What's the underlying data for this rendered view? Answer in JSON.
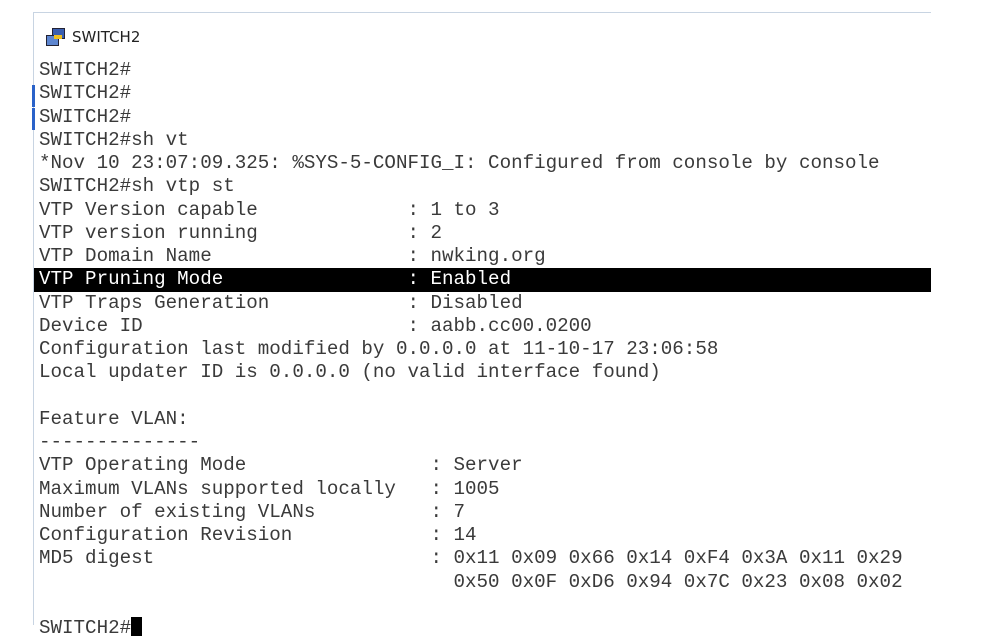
{
  "window": {
    "title": "SWITCH2",
    "icon": "network-terminal-icon"
  },
  "terminal": {
    "lines": [
      "SWITCH2#",
      "SWITCH2#",
      "SWITCH2#",
      "SWITCH2#sh vt",
      "*Nov 10 23:07:09.325: %SYS-5-CONFIG_I: Configured from console by console",
      "SWITCH2#sh vtp st",
      "VTP Version capable             : 1 to 3",
      "VTP version running             : 2",
      "VTP Domain Name                 : nwking.org",
      "VTP Pruning Mode                : Enabled",
      "VTP Traps Generation            : Disabled",
      "Device ID                       : aabb.cc00.0200",
      "Configuration last modified by 0.0.0.0 at 11-10-17 23:06:58",
      "Local updater ID is 0.0.0.0 (no valid interface found)",
      "",
      "Feature VLAN:",
      "--------------",
      "VTP Operating Mode                : Server",
      "Maximum VLANs supported locally   : 1005",
      "Number of existing VLANs          : 7",
      "Configuration Revision            : 14",
      "MD5 digest                        : 0x11 0x09 0x66 0x14 0xF4 0x3A 0x11 0x29",
      "                                    0x50 0x0F 0xD6 0x94 0x7C 0x23 0x08 0x02",
      "",
      "SWITCH2#"
    ],
    "highlighted_line": 9
  }
}
